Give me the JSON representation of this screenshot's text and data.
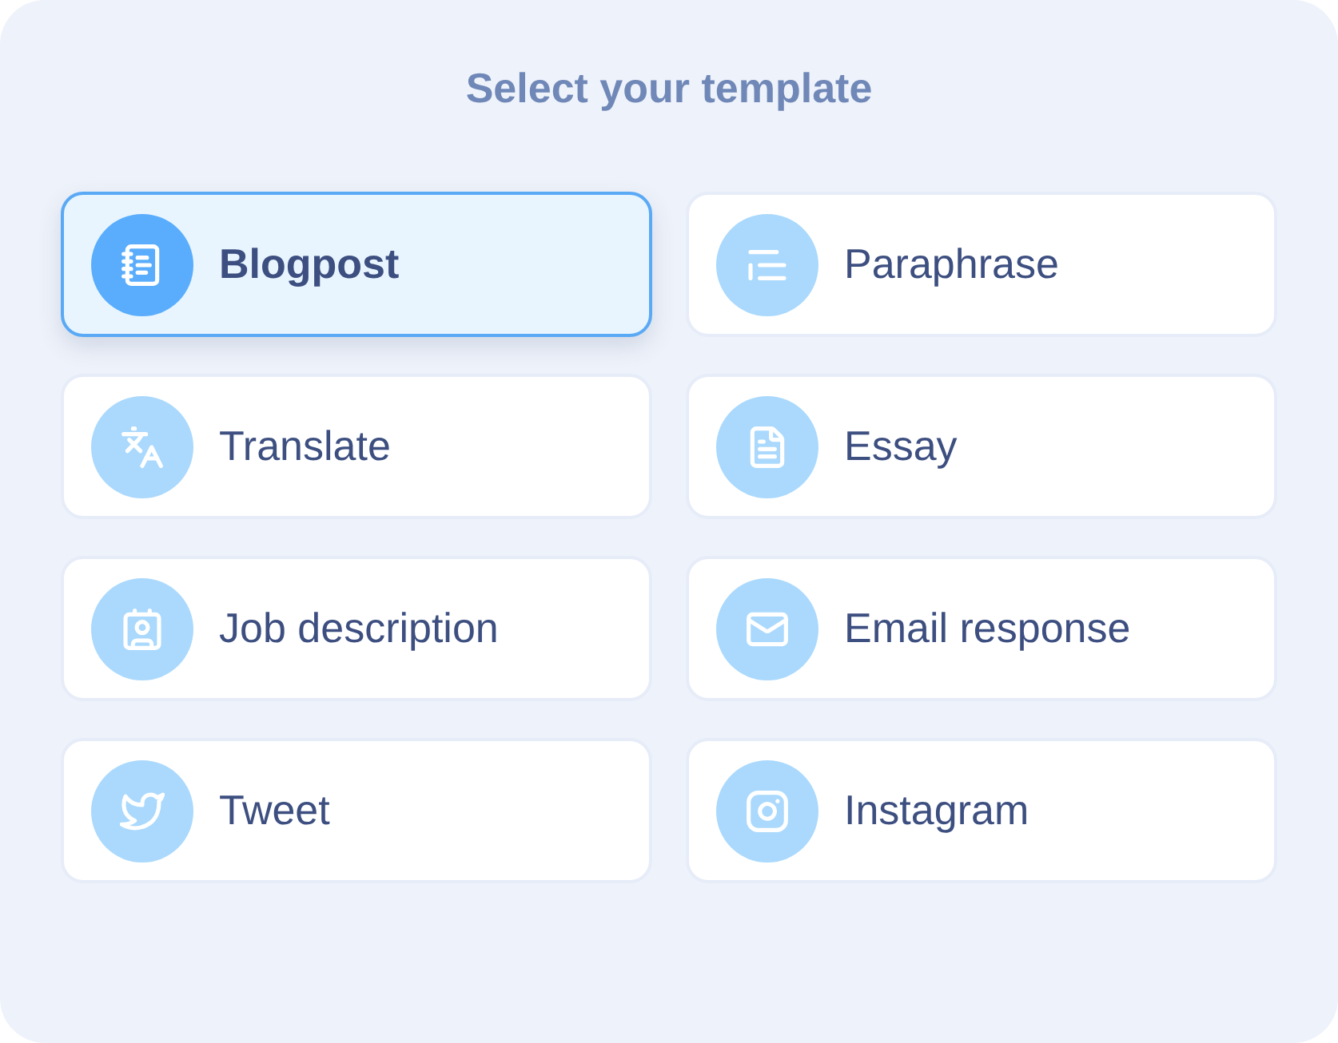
{
  "title": "Select your template",
  "templates": [
    {
      "label": "Blogpost",
      "kind": "blog",
      "selected": true
    },
    {
      "label": "Paraphrase",
      "kind": "paraphrase",
      "selected": false
    },
    {
      "label": "Translate",
      "kind": "translate",
      "selected": false
    },
    {
      "label": "Essay",
      "kind": "essay",
      "selected": false
    },
    {
      "label": "Job description",
      "kind": "job",
      "selected": false
    },
    {
      "label": "Email response",
      "kind": "email",
      "selected": false
    },
    {
      "label": "Tweet",
      "kind": "tweet",
      "selected": false
    },
    {
      "label": "Instagram",
      "kind": "instagram",
      "selected": false
    }
  ]
}
